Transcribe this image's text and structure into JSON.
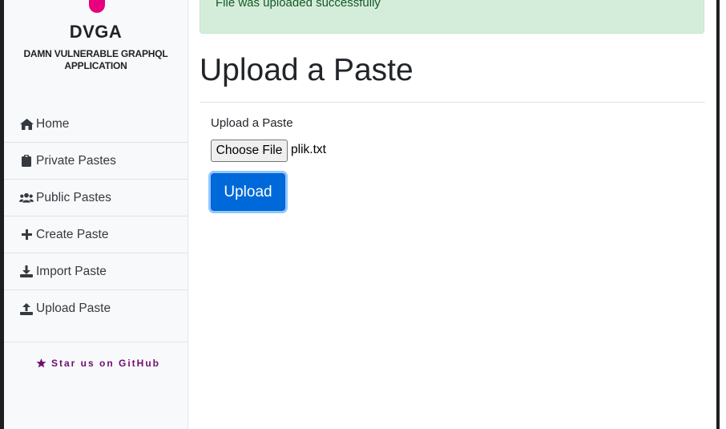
{
  "brand": {
    "title": "DVGA",
    "subtitle": "DAMN VULNERABLE GRAPHQL APPLICATION",
    "logo_color": "#e6007e"
  },
  "sidebar": {
    "items": [
      {
        "label": "Home",
        "icon": "home-icon"
      },
      {
        "label": "Private Pastes",
        "icon": "clipboard-icon"
      },
      {
        "label": "Public Pastes",
        "icon": "users-icon"
      },
      {
        "label": "Create Paste",
        "icon": "plus-icon"
      },
      {
        "label": "Import Paste",
        "icon": "download-icon"
      },
      {
        "label": "Upload Paste",
        "icon": "upload-icon"
      }
    ],
    "github_label": "Star us on GitHub",
    "github_icon": "star-icon",
    "github_color": "#6f0d6f"
  },
  "alert": {
    "message": "File was uploaded successfully",
    "color": "#d4edda"
  },
  "main": {
    "title": "Upload a Paste",
    "field_label": "Upload a Paste",
    "choose_file_label": "Choose File",
    "file_name": "plik.txt",
    "upload_label": "Upload",
    "accent_color": "#0069d9"
  }
}
